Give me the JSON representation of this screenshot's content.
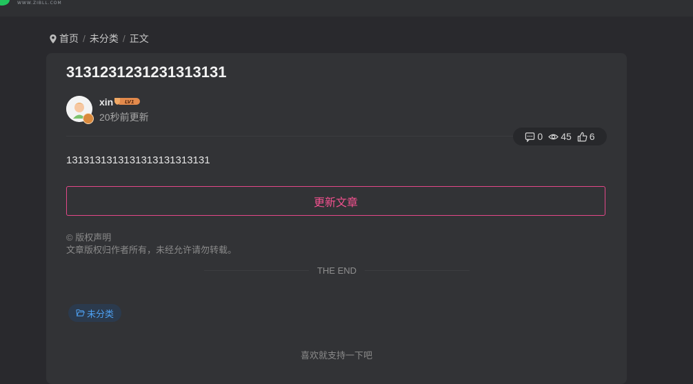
{
  "header": {
    "logo_text": "WWW.ZIBLL.COM"
  },
  "breadcrumb": {
    "items": [
      "首页",
      "未分类",
      "正文"
    ],
    "separator": "/"
  },
  "article": {
    "title": "3131231231231313131",
    "author": {
      "name": "xin",
      "level": "LV1"
    },
    "update_time": "20秒前更新",
    "stats": {
      "comments": "0",
      "views": "45",
      "likes": "6"
    },
    "content": "1313131313131313131313131",
    "update_button": "更新文章",
    "copyright_title": "© 版权声明",
    "copyright_text": "文章版权归作者所有，未经允许请勿转载。",
    "end_text": "THE END",
    "tag": "未分类",
    "support_text": "喜欢就支持一下吧"
  },
  "colors": {
    "accent": "#f2518f",
    "tag": "#4ea1f3",
    "background": "#29292d",
    "card": "#323336"
  },
  "icons": [
    "map-pin-icon",
    "comment-icon",
    "eye-icon",
    "thumbs-up-icon",
    "folder-icon",
    "level-shield-icon"
  ]
}
